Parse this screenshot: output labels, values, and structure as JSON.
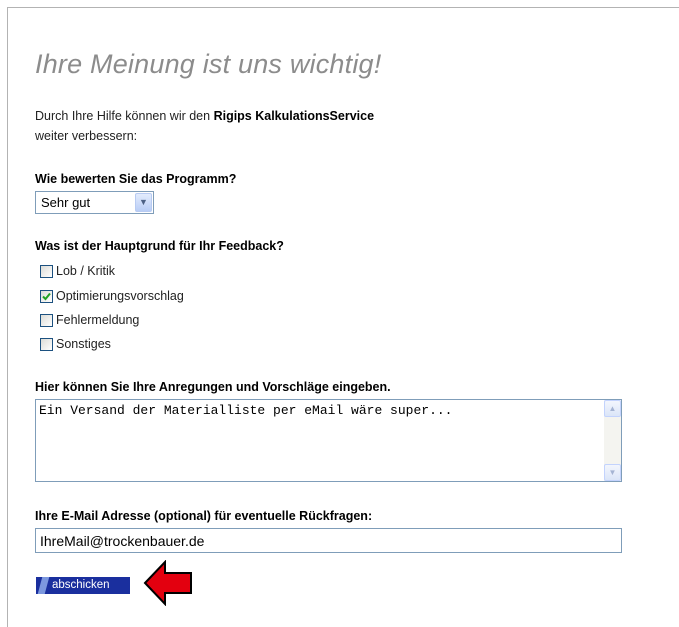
{
  "heading": "Ihre Meinung ist uns wichtig!",
  "intro": {
    "prefix": "Durch Ihre Hilfe können wir den ",
    "brand": "Rigips KalkulationsService",
    "line2": "weiter verbessern:"
  },
  "rating": {
    "label": "Wie bewerten Sie das Programm?",
    "selected": "Sehr gut"
  },
  "reason": {
    "label": "Was ist der Hauptgrund für Ihr Feedback?",
    "options": [
      {
        "label": "Lob / Kritik",
        "checked": false
      },
      {
        "label": "Optimierungsvorschlag",
        "checked": true
      },
      {
        "label": "Fehlermeldung",
        "checked": false
      },
      {
        "label": "Sonstiges",
        "checked": false
      }
    ]
  },
  "suggestions": {
    "label": "Hier können Sie Ihre Anregungen und Vorschläge eingeben.",
    "value": "Ein Versand der Materialliste per eMail wäre super..."
  },
  "email": {
    "label": "Ihre E-Mail Adresse (optional) für eventuelle Rückfragen:",
    "value": "IhreMail@trockenbauer.de"
  },
  "submit_label": "abschicken",
  "colors": {
    "heading": "#8c8c8c",
    "submit_bg": "#1a2f9e",
    "arrow": "#e3000f",
    "check": "#21a121"
  }
}
